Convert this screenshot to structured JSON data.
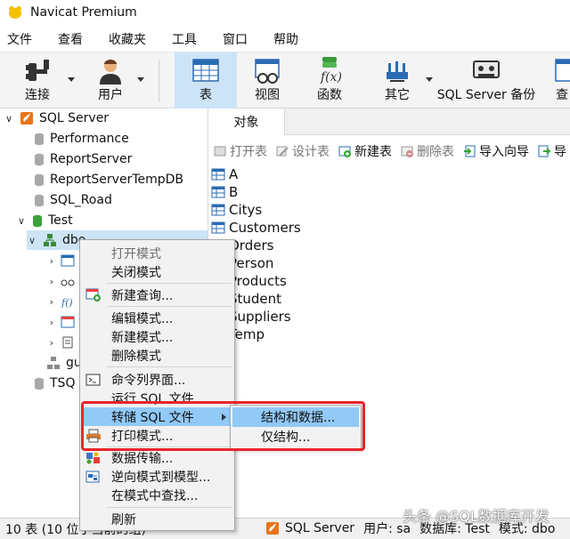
{
  "window": {
    "title": "Navicat Premium"
  },
  "menu": [
    "文件",
    "查看",
    "收藏夹",
    "工具",
    "窗口",
    "帮助"
  ],
  "toolbar": {
    "connect": "连接",
    "user": "用户",
    "table": "表",
    "view": "视图",
    "function": "函数",
    "other": "其它",
    "backup": "SQL Server 备份",
    "query": "查"
  },
  "tree": {
    "server": "SQL Server",
    "databases": [
      "Performance",
      "ReportServer",
      "ReportServerTempDB",
      "SQL_Road"
    ],
    "test_db": "Test",
    "schema": "dbo",
    "schema2": "gu",
    "tsql": "TSQ"
  },
  "tabs": {
    "objects": "对象"
  },
  "object_toolbar": {
    "open": "打开表",
    "design": "设计表",
    "new": "新建表",
    "delete": "删除表",
    "import": "导入向导",
    "export": "导"
  },
  "objects": [
    "A",
    "B",
    "Citys",
    "Customers",
    "Orders",
    "Person",
    "Products",
    "Student",
    "Suppliers",
    "Temp"
  ],
  "context_menu": {
    "open_schema": "打开模式",
    "close_schema": "关闭模式",
    "new_query": "新建查询...",
    "edit_schema": "编辑模式...",
    "new_schema": "新建模式...",
    "delete_schema": "删除模式",
    "console": "命令列界面...",
    "run_sql": "运行 SQL 文件...",
    "dump_sql": "转储 SQL 文件",
    "print_schema": "打印模式...",
    "data_transfer": "数据传输...",
    "reverse_model": "逆向模式到模型...",
    "find_in_schema": "在模式中查找...",
    "refresh": "刷新"
  },
  "submenu": {
    "structure_data": "结构和数据...",
    "structure_only": "仅结构..."
  },
  "status": {
    "count": "10 表 (10 位于当前的组)",
    "connection": "SQL Server",
    "user": "用户: sa",
    "database": "数据库: Test",
    "schema": "模式: dbo"
  },
  "watermark": "头条 @SQL数据库开发",
  "colors": {
    "selection": "#cde4f7",
    "menu_highlight": "#91c9f7",
    "callout": "#e8252b"
  }
}
